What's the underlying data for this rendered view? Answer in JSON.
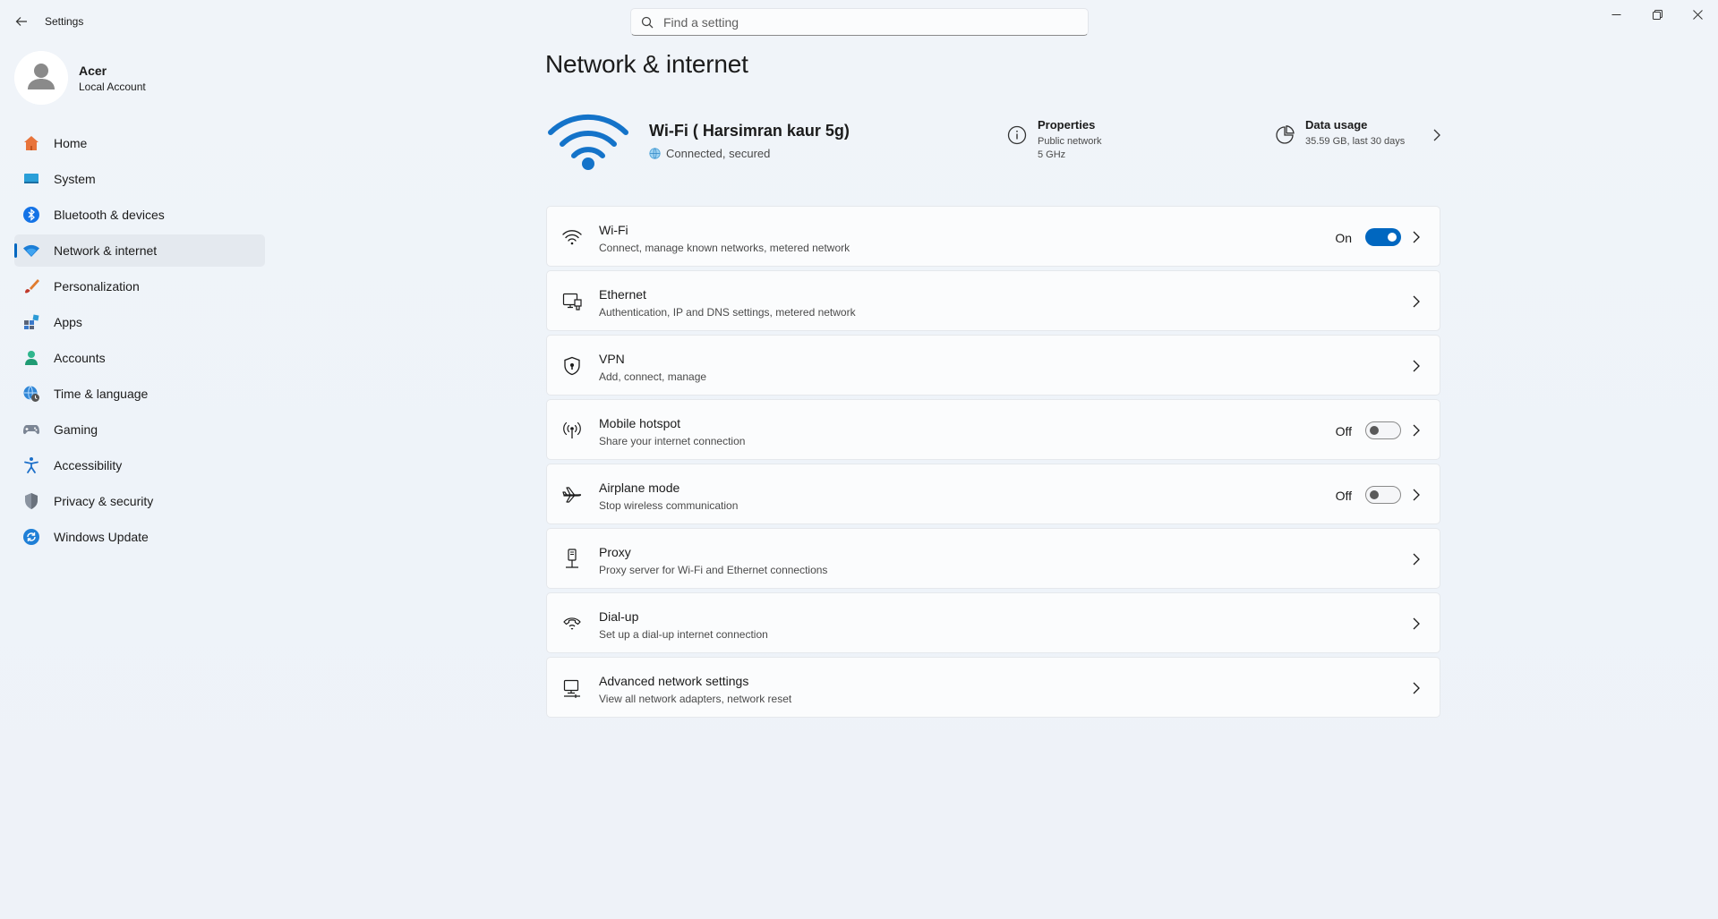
{
  "app": {
    "title": "Settings",
    "search_placeholder": "Find a setting"
  },
  "profile": {
    "name": "Acer",
    "account_type": "Local Account"
  },
  "sidebar": {
    "items": [
      {
        "label": "Home",
        "icon": "home-icon"
      },
      {
        "label": "System",
        "icon": "system-icon"
      },
      {
        "label": "Bluetooth & devices",
        "icon": "bluetooth-icon"
      },
      {
        "label": "Network & internet",
        "icon": "network-icon",
        "active": true
      },
      {
        "label": "Personalization",
        "icon": "brush-icon"
      },
      {
        "label": "Apps",
        "icon": "apps-icon"
      },
      {
        "label": "Accounts",
        "icon": "accounts-icon"
      },
      {
        "label": "Time & language",
        "icon": "globe-clock-icon"
      },
      {
        "label": "Gaming",
        "icon": "controller-icon"
      },
      {
        "label": "Accessibility",
        "icon": "accessibility-icon"
      },
      {
        "label": "Privacy & security",
        "icon": "shield-icon"
      },
      {
        "label": "Windows Update",
        "icon": "update-icon"
      }
    ]
  },
  "main": {
    "page_title": "Network & internet",
    "connection": {
      "ssid": "Wi-Fi ( Harsimran kaur 5g)",
      "status": "Connected, secured",
      "properties_title": "Properties",
      "properties_line1": "Public network",
      "properties_line2": "5 GHz",
      "usage_title": "Data usage",
      "usage_value": "35.59 GB, last 30 days"
    },
    "cards": [
      {
        "title": "Wi-Fi",
        "subtitle": "Connect, manage known networks, metered network",
        "state": "On",
        "icon": "wifi-icon"
      },
      {
        "title": "Ethernet",
        "subtitle": "Authentication, IP and DNS settings, metered network",
        "icon": "ethernet-icon"
      },
      {
        "title": "VPN",
        "subtitle": "Add, connect, manage",
        "icon": "vpn-shield-icon"
      },
      {
        "title": "Mobile hotspot",
        "subtitle": "Share your internet connection",
        "state": "Off",
        "icon": "hotspot-icon"
      },
      {
        "title": "Airplane mode",
        "subtitle": "Stop wireless communication",
        "state": "Off",
        "icon": "airplane-icon"
      },
      {
        "title": "Proxy",
        "subtitle": "Proxy server for Wi-Fi and Ethernet connections",
        "icon": "proxy-icon"
      },
      {
        "title": "Dial-up",
        "subtitle": "Set up a dial-up internet connection",
        "icon": "dialup-icon"
      },
      {
        "title": "Advanced network settings",
        "subtitle": "View all network adapters, network reset",
        "icon": "advanced-network-icon"
      }
    ]
  },
  "colors": {
    "accent": "#0067c0",
    "background": "#eef3f9",
    "card": "#fbfcfd"
  }
}
